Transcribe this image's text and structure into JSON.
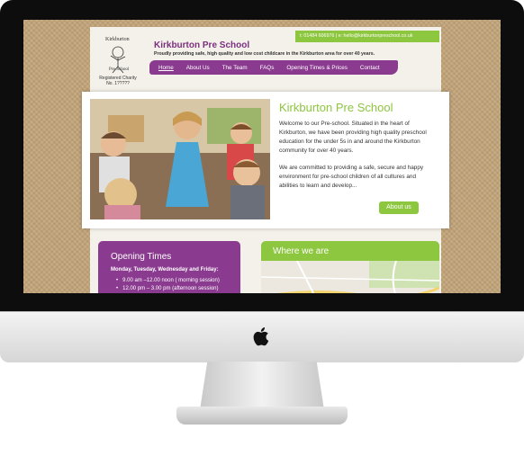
{
  "site": {
    "title": "Kirkburton Pre School",
    "tagline": "Proudly providing safe, high quality and low cost childcare in the Kirkburton area for over 40 years.",
    "contact": "t: 01484 606976  |  e: hello@kirkburtonpreschool.co.uk",
    "logo": {
      "registered_line1": "Registered Charity",
      "registered_line2": "No. 1?????"
    }
  },
  "nav": {
    "items": [
      {
        "label": "Home",
        "active": true
      },
      {
        "label": "About Us"
      },
      {
        "label": "The Team"
      },
      {
        "label": "FAQs"
      },
      {
        "label": "Opening Times & Prices"
      },
      {
        "label": "Contact"
      }
    ]
  },
  "hero": {
    "title": "Kirkburton Pre School",
    "paragraph1": "Welcome to our Pre-school. Situated in the heart of Kirkburton, we have been providing high quality preschool education for the under 5s in and around the Kirkburton community for over 40 years.",
    "paragraph2": "We are committed to providing a safe, secure and happy environment for pre-school children of all cultures and abilities to learn and develop...",
    "button": "About us"
  },
  "opening": {
    "title": "Opening Times",
    "days": "Monday, Tuesday, Wednesday and Friday:",
    "sessions": [
      "9.00 am –12.00 noon ( morning session)",
      "12.00 pm – 3.00 pm (afternoon session)"
    ]
  },
  "where": {
    "title": "Where we are"
  },
  "colors": {
    "purple": "#8a3b8f",
    "green": "#8dc63f",
    "title_purple": "#7b2f7f"
  }
}
